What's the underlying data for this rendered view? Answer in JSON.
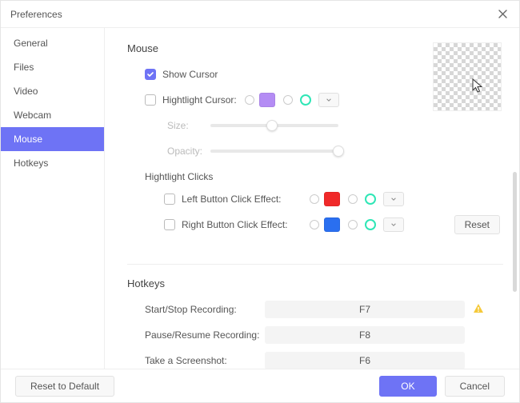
{
  "window": {
    "title": "Preferences"
  },
  "sidebar": {
    "items": [
      {
        "label": "General"
      },
      {
        "label": "Files"
      },
      {
        "label": "Video"
      },
      {
        "label": "Webcam"
      },
      {
        "label": "Mouse"
      },
      {
        "label": "Hotkeys"
      }
    ],
    "activeIndex": 4
  },
  "mouse": {
    "section_title": "Mouse",
    "show_cursor_label": "Show Cursor",
    "show_cursor_checked": true,
    "highlight_cursor_label": "Hightlight Cursor:",
    "highlight_cursor_checked": false,
    "highlight_cursor_solid_color": "#b48cf4",
    "highlight_cursor_ring_color": "#2fe6b6",
    "size_label": "Size:",
    "size_value_pct": 48,
    "opacity_label": "Opacity:",
    "opacity_value_pct": 100,
    "highlight_clicks_title": "Hightlight Clicks",
    "left_click_label": "Left Button Click Effect:",
    "left_click_checked": false,
    "left_click_solid_color": "#f02929",
    "left_click_ring_color": "#2fe6b6",
    "right_click_label": "Right Button Click Effect:",
    "right_click_checked": false,
    "right_click_solid_color": "#2a6ff0",
    "right_click_ring_color": "#2fe6b6",
    "reset_label": "Reset"
  },
  "hotkeys": {
    "section_title": "Hotkeys",
    "rows": [
      {
        "label": "Start/Stop Recording:",
        "value": "F7",
        "warn": true
      },
      {
        "label": "Pause/Resume Recording:",
        "value": "F8",
        "warn": false
      },
      {
        "label": "Take a Screenshot:",
        "value": "F6",
        "warn": false
      }
    ]
  },
  "footer": {
    "reset_default": "Reset to Default",
    "ok": "OK",
    "cancel": "Cancel"
  }
}
